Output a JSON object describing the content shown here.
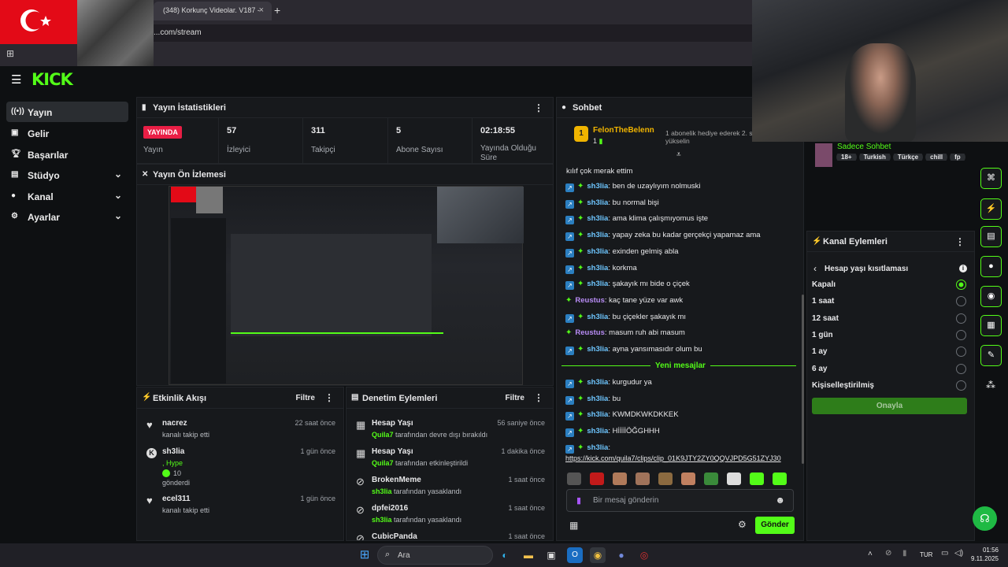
{
  "browser": {
    "tab_title": "(348) Korkunç Videolar. V187 -",
    "url": "...com/stream",
    "close": "×",
    "new_tab": "+"
  },
  "header": {
    "logo": "KICK"
  },
  "sidebar": {
    "items": [
      {
        "label": "Yayın",
        "icon": "broadcast-icon"
      },
      {
        "label": "Gelir",
        "icon": "wallet-icon"
      },
      {
        "label": "Başarılar",
        "icon": "trophy-icon"
      },
      {
        "label": "Stüdyo",
        "icon": "studio-icon"
      },
      {
        "label": "Kanal",
        "icon": "person-icon"
      },
      {
        "label": "Ayarlar",
        "icon": "gear-icon"
      }
    ]
  },
  "stats": {
    "title": "Yayın İstatistikleri",
    "live_badge": "YAYINDA",
    "live_label": "Yayın",
    "viewers": "57",
    "viewers_label": "İzleyici",
    "followers": "311",
    "followers_label": "Takipçi",
    "subs": "5",
    "subs_label": "Abone Sayısı",
    "duration": "02:18:55",
    "duration_label": "Yayında Olduğu Süre"
  },
  "preview": {
    "title": "Yayın Ön İzlemesi"
  },
  "activity": {
    "title": "Etkinlik Akışı",
    "filter": "Filtre",
    "items": [
      {
        "name": "nacrez",
        "desc": "kanalı takip etti",
        "time": "22 saat önce",
        "icon": "heart-icon"
      },
      {
        "name": "sh3lia",
        "desc": ", Hype",
        "desc2": "10",
        "desc3": "gönderdi",
        "time": "1 gün önce",
        "icon": "kick-icon"
      },
      {
        "name": "ecel311",
        "desc": "kanalı takip etti",
        "time": "1 gün önce",
        "icon": "heart-icon"
      }
    ]
  },
  "moderation": {
    "title": "Denetim Eylemleri",
    "filter": "Filtre",
    "items": [
      {
        "name": "Hesap Yaşı",
        "user": "Quila7",
        "desc": "tarafından devre dışı bırakıldı",
        "time": "56 saniye önce",
        "icon": "calendar-icon"
      },
      {
        "name": "Hesap Yaşı",
        "user": "Quila7",
        "desc": "tarafından etkinleştirildi",
        "time": "1 dakika önce",
        "icon": "calendar-icon"
      },
      {
        "name": "BrokenMeme",
        "user": "sh3lia",
        "desc": "tarafından yasaklandı",
        "time": "1 saat önce",
        "icon": "ban-icon"
      },
      {
        "name": "dpfei2016",
        "user": "sh3lia",
        "desc": "tarafından yasaklandı",
        "time": "1 saat önce",
        "icon": "ban-icon"
      },
      {
        "name": "CubicPanda",
        "user": "",
        "desc": "",
        "time": "1 saat önce",
        "icon": "ban-icon"
      }
    ]
  },
  "chat": {
    "title": "Sohbet",
    "pinned_user": "FelonTheBelenn",
    "pinned_level": "1",
    "gift_text": "1 abonelik hediye ederek 2. s",
    "gift_text2": "yükselin",
    "top_msg": "kılıf çok merak ettim",
    "messages": [
      {
        "user": "sh3lia",
        "text": ": ben de uzaylıyım nolmuski",
        "cls": "u1"
      },
      {
        "user": "sh3lia",
        "text": ": bu normal bişi",
        "cls": "u1"
      },
      {
        "user": "sh3lia",
        "text": ": ama klima çalışmıyomus işte",
        "cls": "u1"
      },
      {
        "user": "sh3lia",
        "text": ": yapay zeka bu kadar gerçekçi yapamaz ama",
        "cls": "u1"
      },
      {
        "user": "sh3lia",
        "text": ": exinden gelmiş abla",
        "cls": "u1"
      },
      {
        "user": "sh3lia",
        "text": ": korkma",
        "cls": "u1"
      },
      {
        "user": "sh3lia",
        "text": ": şakayık mı bide o çiçek",
        "cls": "u1"
      },
      {
        "user": "Reustus",
        "text": ": kaç tane yüze var awk",
        "cls": "u2"
      },
      {
        "user": "sh3lia",
        "text": ": bu çiçekler şakayık mı",
        "cls": "u1"
      },
      {
        "user": "Reustus",
        "text": ": masum ruh abi masum",
        "cls": "u2"
      },
      {
        "user": "sh3lia",
        "text": ": ayna yansımasıdır olum bu",
        "cls": "u1"
      }
    ],
    "new_label": "Yeni mesajlar",
    "messages2": [
      {
        "user": "sh3lia",
        "text": ": kurgudur ya"
      },
      {
        "user": "sh3lia",
        "text": ": bu"
      },
      {
        "user": "sh3lia",
        "text": ": KWMDKWKDKKEK"
      },
      {
        "user": "sh3lia",
        "text": ": HİİİİÖĞGHHH"
      },
      {
        "user": "sh3lia",
        "text": ":"
      }
    ],
    "link": "https://kick.com/quila7/clips/clip_01K9JTY2ZY0QQVJPD5G51ZYJ30",
    "input_placeholder": "Bir mesaj gönderin",
    "send": "Gönder"
  },
  "channel_info": {
    "mode": "Sadece Sohbet",
    "tags": [
      "18+",
      "Turkish",
      "Türkçe",
      "chill",
      "fp"
    ]
  },
  "channel_actions": {
    "title": "Kanal Eylemleri",
    "sub_title": "Hesap yaşı kısıtlaması",
    "options": [
      "Kapalı",
      "1 saat",
      "12 saat",
      "1 gün",
      "1 ay",
      "6 ay",
      "Kişiselleştirilmiş"
    ],
    "selected": 0,
    "confirm": "Onayla"
  },
  "taskbar": {
    "search": "Ara",
    "lang": "TUR",
    "time": "01:56",
    "date": "9.11.2025"
  },
  "colors": {
    "accent": "#53fc18",
    "live": "#e91e45",
    "bg": "#0e1012",
    "panel": "#17191c"
  }
}
